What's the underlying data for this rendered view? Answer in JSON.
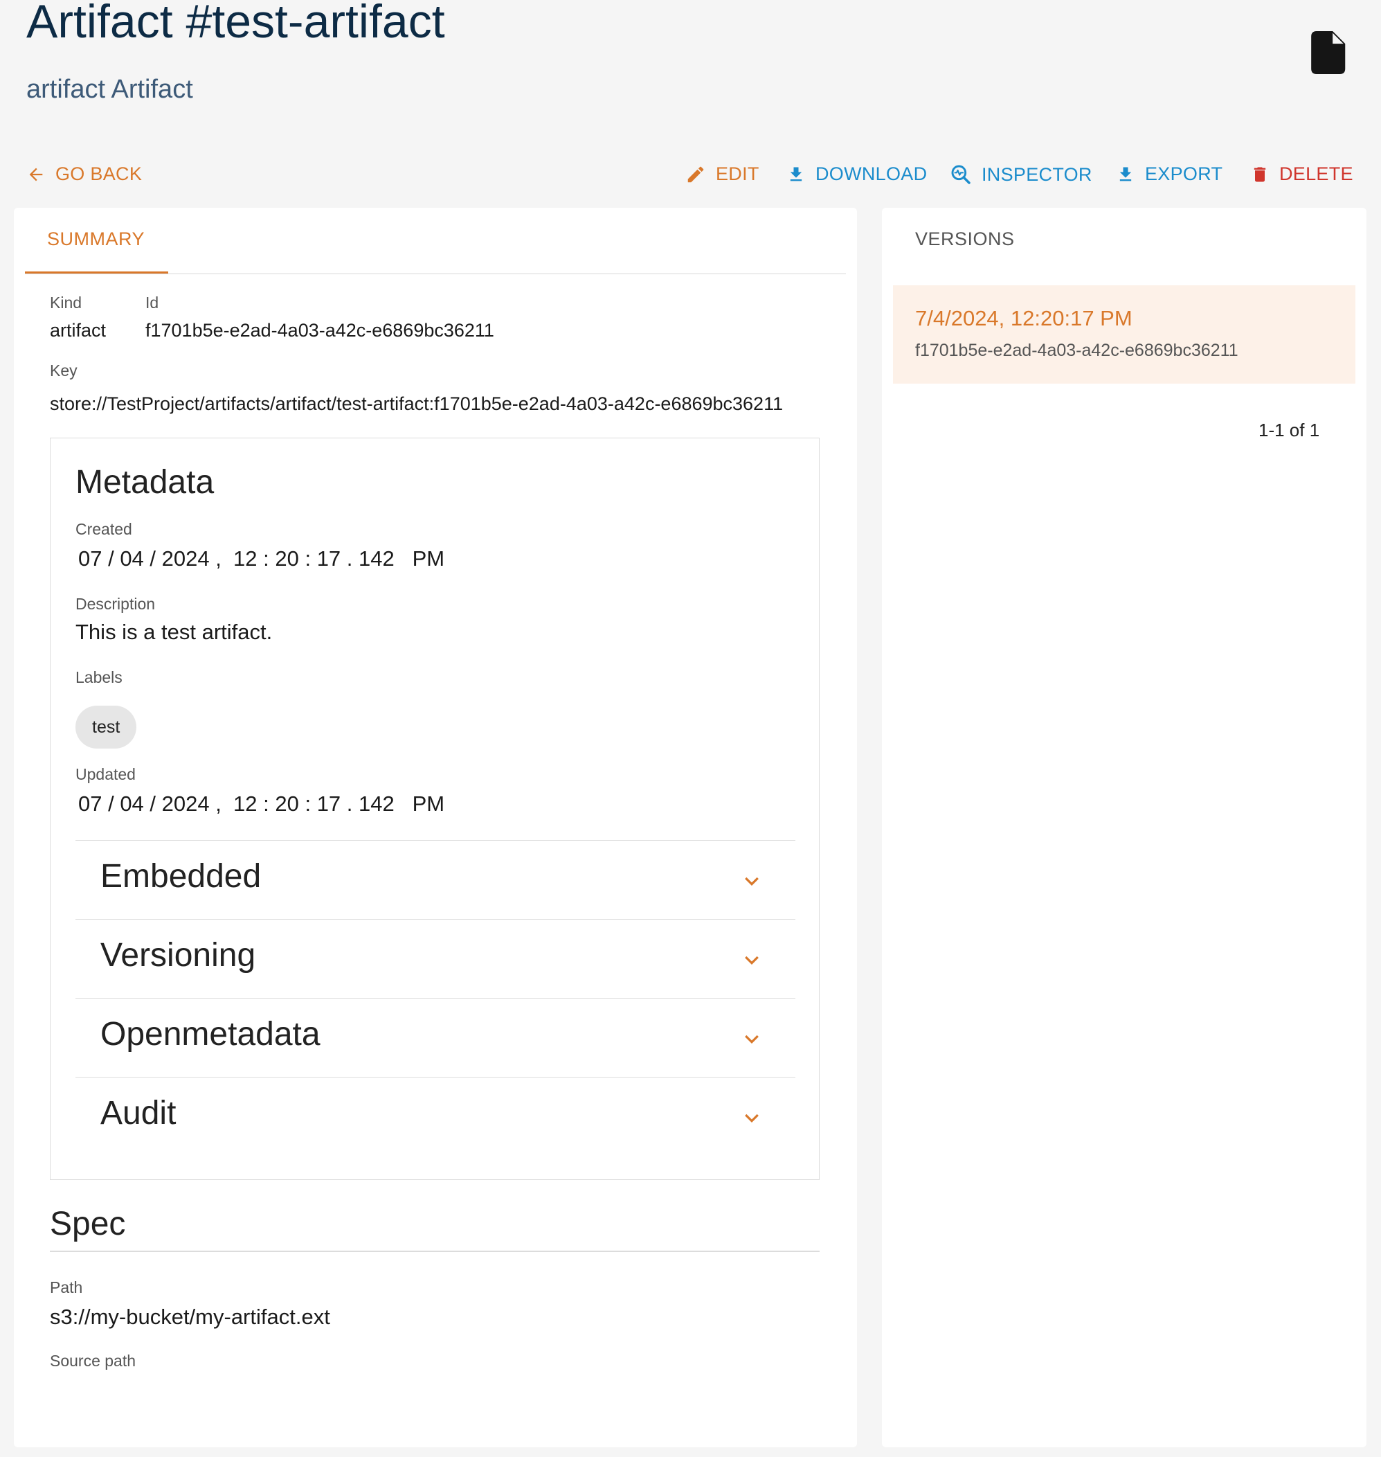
{
  "header": {
    "title": "Artifact #test-artifact",
    "subtitle": "artifact Artifact"
  },
  "toolbar": {
    "go_back": "GO BACK",
    "edit": "EDIT",
    "download": "DOWNLOAD",
    "inspector": "INSPECTOR",
    "export": "EXPORT",
    "delete": "DELETE"
  },
  "tabs": {
    "summary": "SUMMARY"
  },
  "summary": {
    "kind_label": "Kind",
    "kind_value": "artifact",
    "id_label": "Id",
    "id_value": "f1701b5e-e2ad-4a03-a42c-e6869bc36211",
    "key_label": "Key",
    "key_value": "store://TestProject/artifacts/artifact/test-artifact:f1701b5e-e2ad-4a03-a42c-e6869bc36211"
  },
  "metadata": {
    "heading": "Metadata",
    "created_label": "Created",
    "created_value": "07 / 04 / 2024 ,  12 : 20 : 17 . 142   PM",
    "description_label": "Description",
    "description_value": "This is a test artifact.",
    "labels_label": "Labels",
    "labels": [
      "test"
    ],
    "updated_label": "Updated",
    "updated_value": "07 / 04 / 2024 ,  12 : 20 : 17 . 142   PM",
    "sections": [
      "Embedded",
      "Versioning",
      "Openmetadata",
      "Audit"
    ]
  },
  "spec": {
    "heading": "Spec",
    "path_label": "Path",
    "path_value": "s3://my-bucket/my-artifact.ext",
    "source_path_label": "Source path"
  },
  "versions": {
    "heading": "VERSIONS",
    "items": [
      {
        "date": "7/4/2024, 12:20:17 PM",
        "id": "f1701b5e-e2ad-4a03-a42c-e6869bc36211"
      }
    ],
    "pagination": "1-1 of 1"
  },
  "colors": {
    "accent": "#d9782a",
    "link": "#1b8ccc",
    "danger": "#d0352c",
    "title": "#0d2b45"
  }
}
